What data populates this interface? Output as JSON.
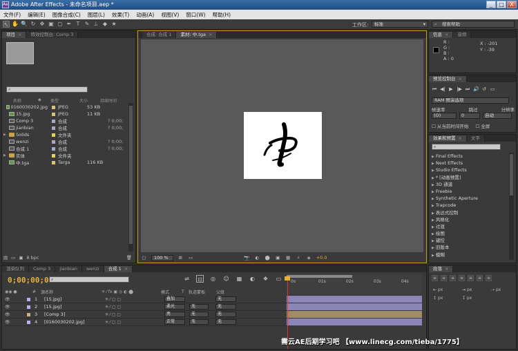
{
  "window": {
    "title": "Adobe After Effects - 未命名项目.aep *",
    "min": "_",
    "max": "□",
    "close": "X"
  },
  "menu": [
    "文件(F)",
    "编辑(E)",
    "图像合成(C)",
    "图层(L)",
    "效果(T)",
    "动画(A)",
    "视图(V)",
    "窗口(W)",
    "帮助(H)"
  ],
  "help_search_placeholder": "搜索帮助",
  "toolbar": {
    "tools": [
      "↖",
      "✋",
      "🔍",
      "↻",
      "✥",
      "▣",
      "◻",
      "✒",
      "T",
      "✎",
      "⊥",
      "◆",
      "★"
    ],
    "workspace_label": "工作区:",
    "workspace_value": "标准",
    "search_placeholder": "搜索帮助"
  },
  "project": {
    "tabs": [
      {
        "label": "项目",
        "close": "×"
      },
      {
        "label": "特效控制台: Comp 3"
      }
    ],
    "search_placeholder": "",
    "headers": [
      "名称",
      "类型",
      "大小",
      "持续时间"
    ],
    "rows": [
      {
        "name": "0160030202.jpg",
        "type": "JPEG",
        "size": "53 KB",
        "dur": "",
        "icon": "img",
        "label": "#d6c37a",
        "expand": ""
      },
      {
        "name": "15.jpg",
        "type": "JPEG",
        "size": "11 KB",
        "dur": "",
        "icon": "img",
        "label": "#d6c37a",
        "expand": ""
      },
      {
        "name": "Comp 3",
        "type": "合成",
        "size": "",
        "dur": "? 0;00;",
        "icon": "comp",
        "label": "#a8a8c8",
        "expand": ""
      },
      {
        "name": "jianbian",
        "type": "合成",
        "size": "",
        "dur": "? 0;00;",
        "icon": "comp",
        "label": "#a8a8c8",
        "expand": ""
      },
      {
        "name": "Solids",
        "type": "文件夹",
        "size": "",
        "dur": "",
        "icon": "folder",
        "label": "#e6d35a",
        "expand": "▶"
      },
      {
        "name": "wenzi",
        "type": "合成",
        "size": "",
        "dur": "? 0;00;",
        "icon": "comp",
        "label": "#a8a8c8",
        "expand": ""
      },
      {
        "name": "合成 1",
        "type": "合成",
        "size": "",
        "dur": "? 0;00;",
        "icon": "comp",
        "label": "#a8a8c8",
        "expand": ""
      },
      {
        "name": "实体",
        "type": "文件夹",
        "size": "",
        "dur": "",
        "icon": "folder",
        "label": "#e6d35a",
        "expand": "▶"
      },
      {
        "name": "中.tga",
        "type": "Targa",
        "size": "116 KB",
        "dur": "",
        "icon": "img",
        "label": "#d6c37a",
        "expand": ""
      }
    ],
    "bpc": "8 bpc"
  },
  "viewer": {
    "tabs": [
      {
        "label": "合成: 合成 1"
      },
      {
        "label": "素材: 中.tga",
        "close": "×"
      }
    ],
    "zoom": "100 %",
    "plus": "+0.0"
  },
  "info": {
    "tabs": [
      {
        "label": "信息",
        "close": "×"
      },
      {
        "label": "音频"
      }
    ],
    "r": "R :",
    "g": "G :",
    "b": "B :",
    "a": "A : 0",
    "x": "X : -201",
    "y": "Y : -39",
    "swatch_color": "#000000"
  },
  "preview": {
    "tabs": [
      {
        "label": "预览控制台",
        "close": "×"
      }
    ],
    "controls": [
      "⏮",
      "◀|",
      "▶",
      "|▶",
      "⏭",
      "🔊",
      "↺",
      "▭"
    ],
    "ram": "RAM 预演选项",
    "frame_rate_label": "帧速率",
    "skip_label": "跳过",
    "resolution_label": "分辨率",
    "frame_rate_value": "(O)",
    "skip_value": "0",
    "resolution_value": "自动",
    "from_current": "从当前时间开始",
    "fullscreen": "全屏"
  },
  "effects": {
    "tabs": [
      {
        "label": "效果和预置",
        "close": "×"
      },
      {
        "label": "文字"
      }
    ],
    "search_placeholder": "",
    "items": [
      "Final Effects",
      "Next Effects",
      "Studio Effects",
      "* [动画预置]",
      "3D 通道",
      "Freebie",
      "Synthetic Aperture",
      "Trapcode",
      "表达式控制",
      "风格化",
      "过渡",
      "绘图",
      "键控",
      "旧版本",
      "模糊"
    ]
  },
  "timeline": {
    "tabs": [
      {
        "label": "渲染队列"
      },
      {
        "label": "Comp 3"
      },
      {
        "label": "jianbian"
      },
      {
        "label": "wenzi"
      },
      {
        "label": "合成 1",
        "close": "×"
      }
    ],
    "timecode": "0;00;00;00",
    "columns": [
      "#",
      "源名称",
      "模式",
      "T",
      "轨道蒙板",
      "父级"
    ],
    "ruler": [
      "0s",
      "01s",
      "02s",
      "03s",
      "04s"
    ],
    "layers": [
      {
        "num": "1",
        "name": "[15.jpg]",
        "mode": "叠加",
        "matte": "",
        "parent": "无",
        "color": "#b3b3e6",
        "bar": "#8c86b8"
      },
      {
        "num": "2",
        "name": "[15.jpg]",
        "mode": "柔光",
        "matte": "无",
        "parent": "无",
        "color": "#b3b3e6",
        "bar": "#8c86b8"
      },
      {
        "num": "3",
        "name": "[Comp 3]",
        "mode": "亮",
        "matte": "无",
        "parent": "无",
        "color": "#c8b27e",
        "bar": "#a08c64"
      },
      {
        "num": "4",
        "name": "[0160030202.jpg]",
        "mode": "正常",
        "matte": "无",
        "parent": "无",
        "color": "#b3b3e6",
        "bar": "#8c86b8"
      }
    ]
  },
  "paragraph": {
    "tabs": [
      {
        "label": "段落",
        "close": "×"
      }
    ],
    "px": "px"
  },
  "watermark": "需云AE后期学习吧 【www.linecg.com/tieba/1775】"
}
